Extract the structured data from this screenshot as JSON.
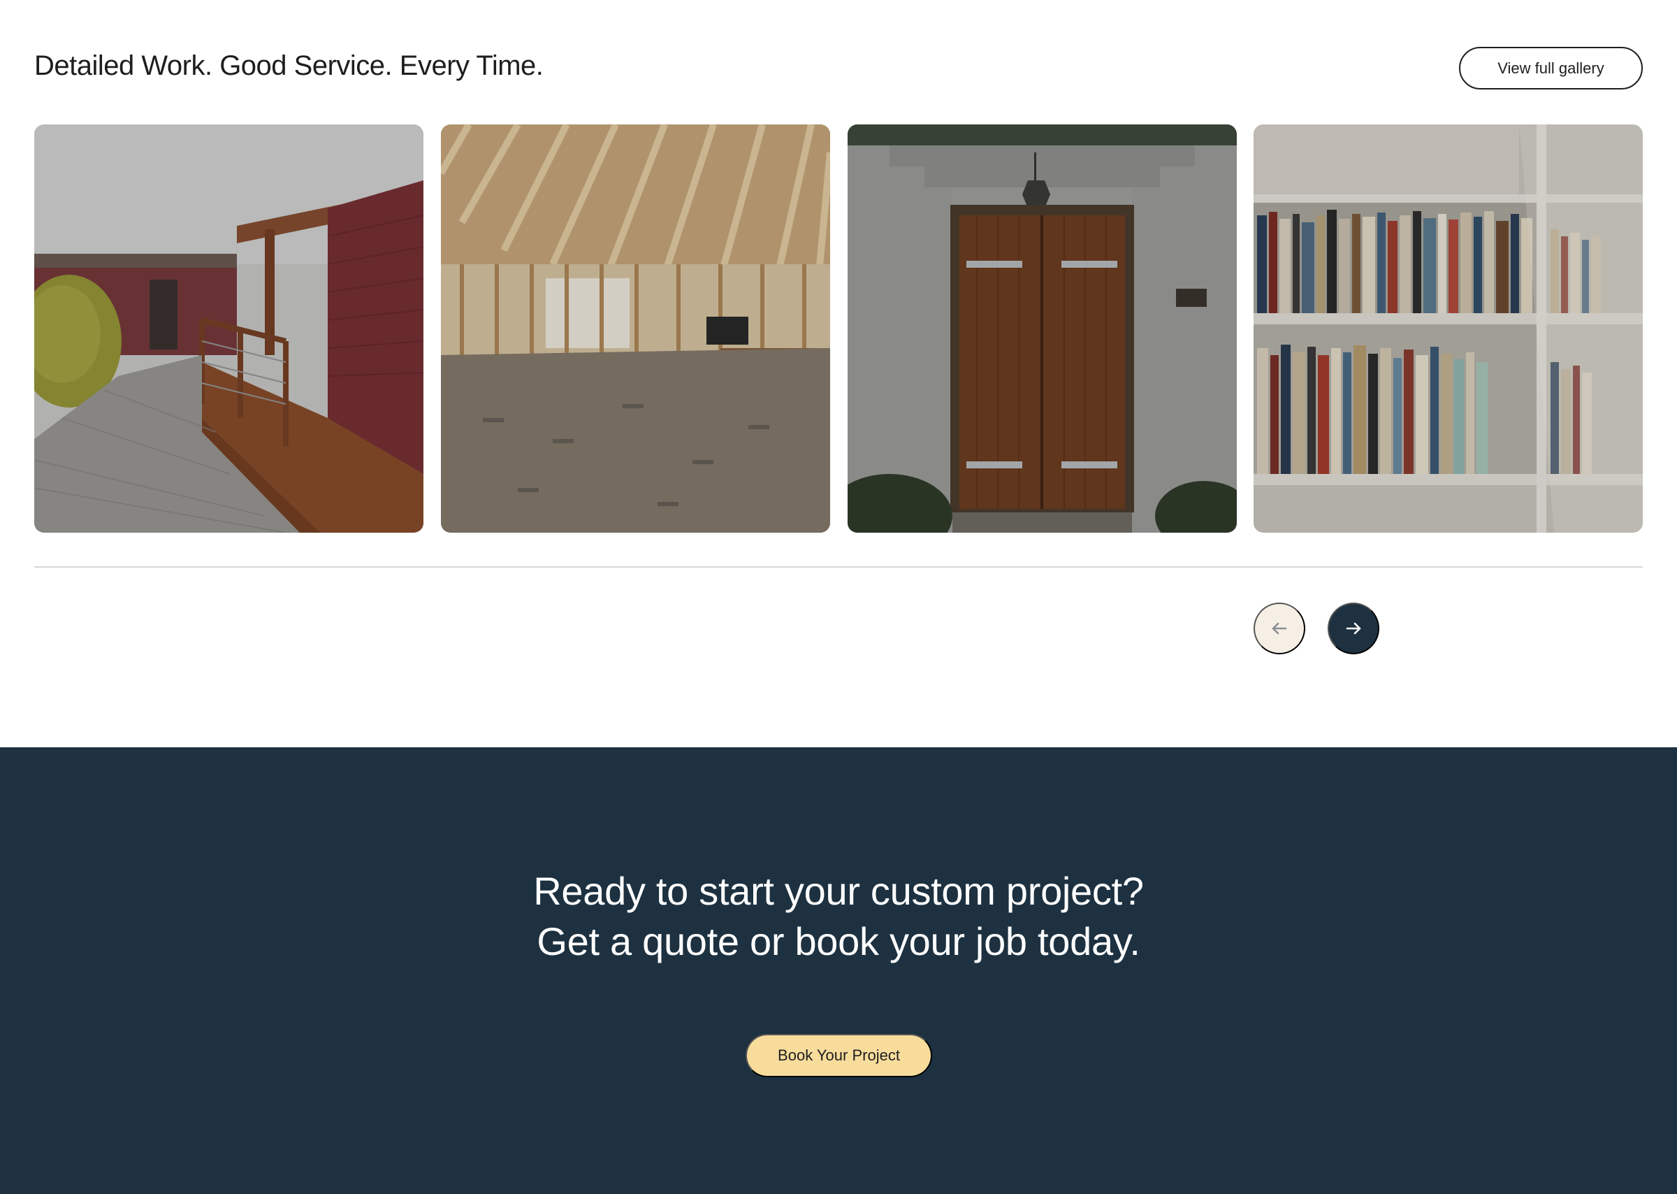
{
  "gallery": {
    "title": "Detailed Work. Good Service. Every Time.",
    "view_gallery_label": "View full gallery",
    "photos": [
      {
        "subject": "wooden deck beside red house with paver path"
      },
      {
        "subject": "interior framing with exposed ceiling joists"
      },
      {
        "subject": "wooden double door in white stucco wall"
      },
      {
        "subject": "built-in white bookshelves filled with books"
      }
    ],
    "prev_icon": "arrow-left-icon",
    "next_icon": "arrow-right-icon"
  },
  "cta": {
    "heading_line1": "Ready to start your custom project?",
    "heading_line2": "Get a quote or book your job today.",
    "button_label": "Book Your Project"
  },
  "colors": {
    "navy": "#1d3140",
    "cream": "#f5efe6",
    "yellow": "#f7dc9c",
    "text": "#1e1e1e"
  }
}
